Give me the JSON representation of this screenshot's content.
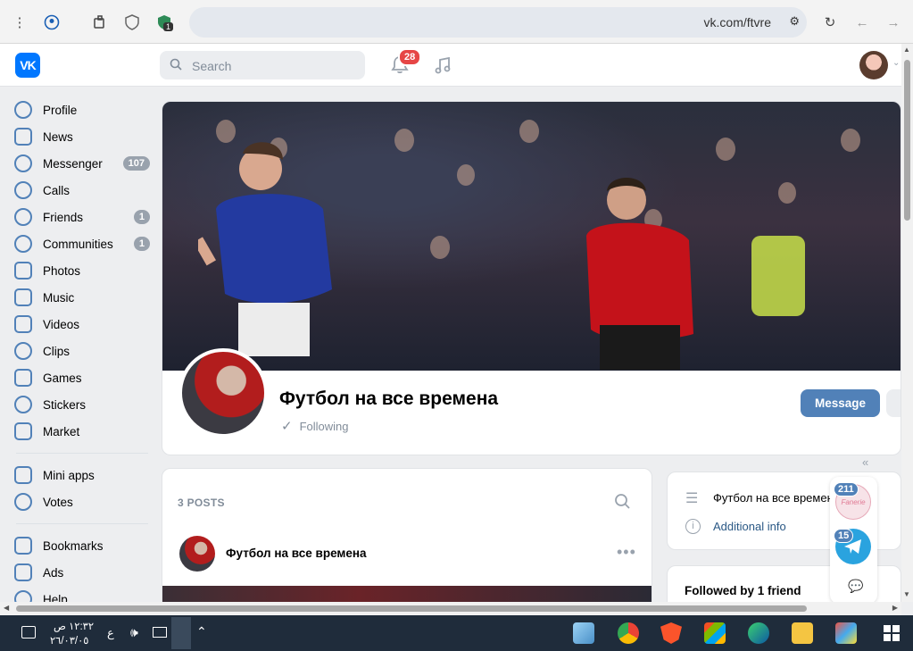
{
  "browser": {
    "url": "vk.com/ftvre",
    "extension_badge": "1"
  },
  "header": {
    "search_placeholder": "Search",
    "notifications_count": "28"
  },
  "sidebar": {
    "items": [
      {
        "label": "Profile",
        "icon": "profile-icon"
      },
      {
        "label": "News",
        "icon": "news-icon"
      },
      {
        "label": "Messenger",
        "icon": "messenger-icon",
        "count": "107"
      },
      {
        "label": "Calls",
        "icon": "calls-icon"
      },
      {
        "label": "Friends",
        "icon": "friends-icon",
        "count": "1"
      },
      {
        "label": "Communities",
        "icon": "communities-icon",
        "count": "1"
      },
      {
        "label": "Photos",
        "icon": "photos-icon"
      },
      {
        "label": "Music",
        "icon": "music-icon"
      },
      {
        "label": "Videos",
        "icon": "videos-icon"
      },
      {
        "label": "Clips",
        "icon": "clips-icon"
      },
      {
        "label": "Games",
        "icon": "games-icon"
      },
      {
        "label": "Stickers",
        "icon": "stickers-icon"
      },
      {
        "label": "Market",
        "icon": "market-icon"
      }
    ],
    "secondary": [
      {
        "label": "Mini apps",
        "icon": "mini-apps-icon"
      },
      {
        "label": "Votes",
        "icon": "votes-icon"
      }
    ],
    "tertiary": [
      {
        "label": "Bookmarks",
        "icon": "bookmarks-icon"
      },
      {
        "label": "Ads",
        "icon": "ads-icon"
      },
      {
        "label": "Help",
        "icon": "help-icon"
      }
    ]
  },
  "community": {
    "name": "Футбол на все времена",
    "status": "Following",
    "message_button": "Message"
  },
  "posts": {
    "count_label": "3 POSTS",
    "post_author": "Футбол на все времена"
  },
  "info": {
    "name": "Футбол на все времена",
    "additional": "Additional info"
  },
  "friends": {
    "title": "Followed by 1 friend"
  },
  "chat_widget": {
    "chat1_badge": "211",
    "chat1_logo": "Fanerie",
    "chat2_badge": "15"
  },
  "taskbar": {
    "time": "١٢:٣٢ ص",
    "date": "٢٦/٠٣/٠٥",
    "lang": "ع"
  },
  "colors": {
    "accent": "#5181b8",
    "vk_blue": "#0077ff",
    "badge_red": "#e64646"
  }
}
